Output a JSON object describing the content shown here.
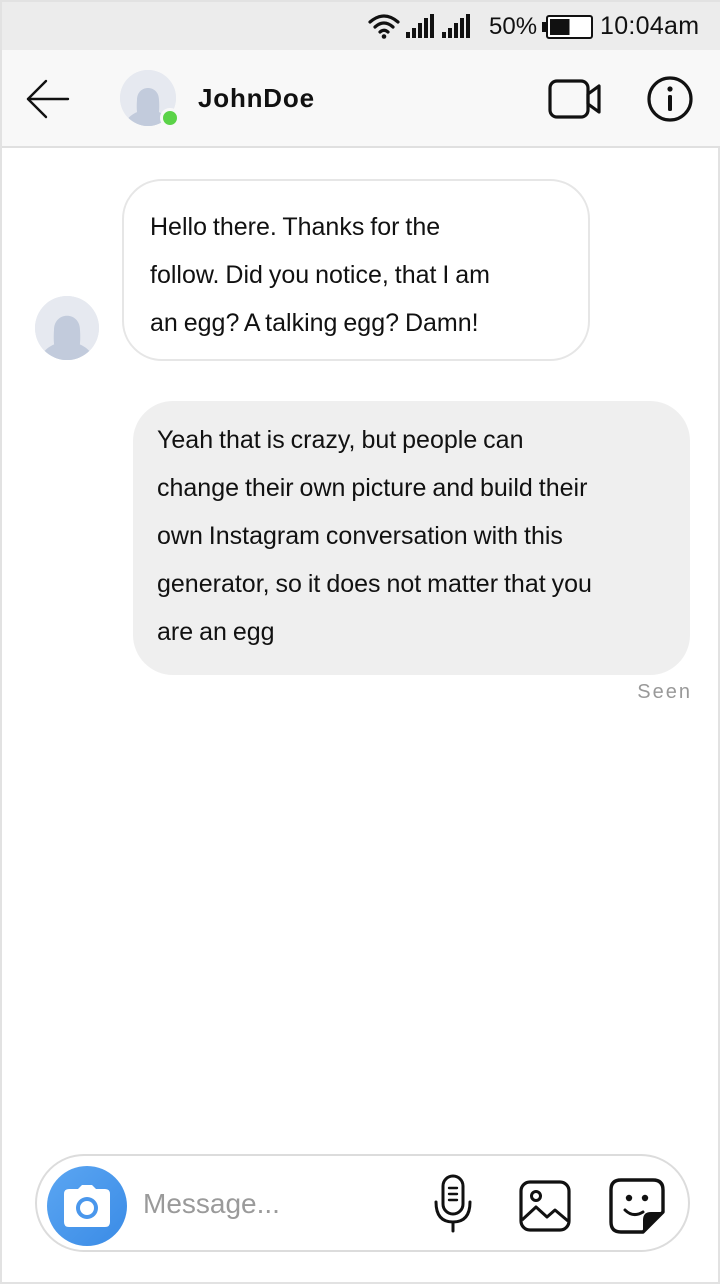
{
  "status_bar": {
    "battery_percent": "50%",
    "battery_level": 0.5,
    "time": "10:04am",
    "icons": [
      "wifi-icon",
      "signal-icon",
      "signal-icon",
      "battery-icon"
    ]
  },
  "header": {
    "username": "JohnDoe",
    "online": true,
    "online_color": "#5bd348",
    "icons": [
      "back-arrow-icon",
      "avatar-icon",
      "video-camera-icon",
      "info-icon"
    ]
  },
  "messages": [
    {
      "direction": "incoming",
      "lines": [
        "Hello there. Thanks for the",
        "follow. Did you notice, that I am",
        "an egg? A talking egg? Damn!"
      ]
    },
    {
      "direction": "outgoing",
      "lines": [
        "Yeah that is crazy, but people can",
        "change their own picture and build their",
        "own Instagram conversation with this",
        "generator, so it does not matter that you",
        "are an egg"
      ]
    }
  ],
  "seen_label": "Seen",
  "composer": {
    "placeholder": "Message...",
    "accent_color": "#3a8be6",
    "icons": [
      "camera-icon",
      "microphone-icon",
      "gallery-icon",
      "sticker-icon"
    ]
  }
}
